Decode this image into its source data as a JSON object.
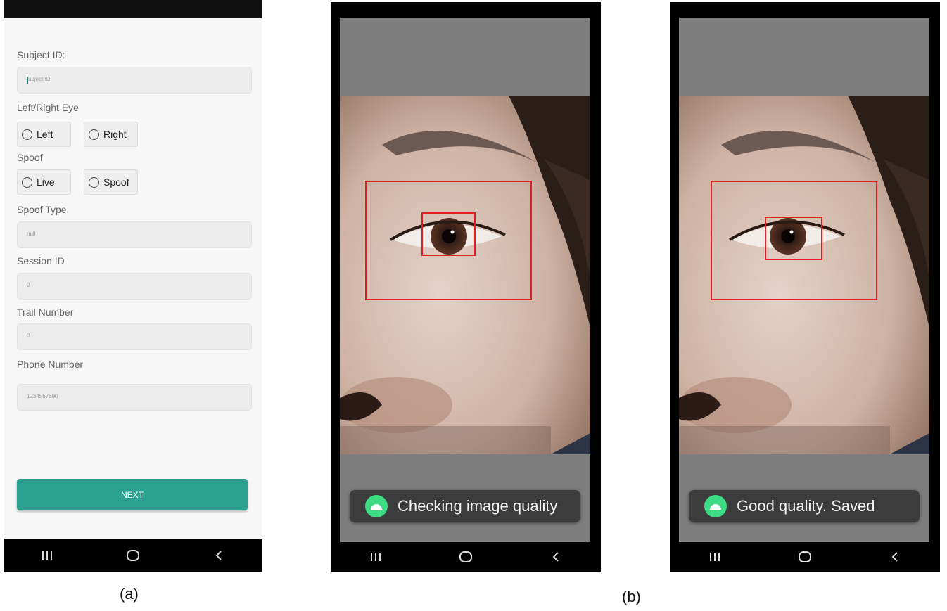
{
  "phone_a": {
    "subject_id_label": "Subject ID:",
    "subject_id_placeholder": "ubject ID",
    "eye_label": "Left/Right Eye",
    "eye_options": [
      "Left",
      "Right"
    ],
    "spoof_label": "Spoof",
    "spoof_options": [
      "Live",
      "Spoof"
    ],
    "spoof_type_label": "Spoof Type",
    "spoof_type_value": "null",
    "session_id_label": "Session ID",
    "session_id_value": "0",
    "trail_number_label": "Trail Number",
    "trail_number_value": "0",
    "phone_number_label": "Phone Number",
    "phone_number_value": "1234567890",
    "next_button": "NEXT",
    "accent_color": "#2aa190"
  },
  "phone_b1": {
    "toast": "Checking image quality"
  },
  "phone_b2": {
    "toast": "Good quality. Saved"
  },
  "nav_icons": [
    "recents-icon",
    "home-icon",
    "back-icon"
  ],
  "captions": {
    "a": "(a)",
    "b": "(b)"
  }
}
